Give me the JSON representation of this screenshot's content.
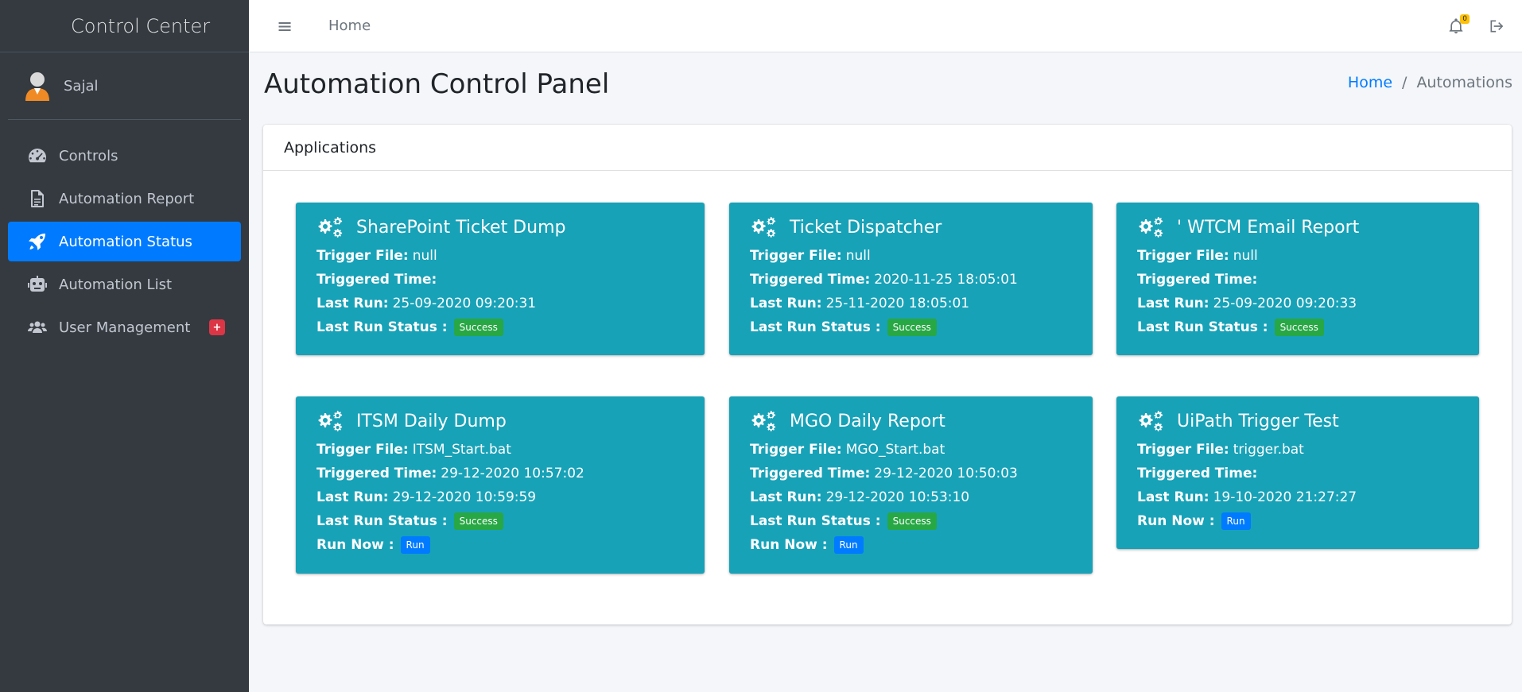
{
  "brand": {
    "title": "Control Center"
  },
  "user": {
    "name": "Sajal"
  },
  "sidebar": {
    "items": [
      {
        "label": "Controls",
        "icon": "tachometer-icon",
        "active": false
      },
      {
        "label": "Automation Report",
        "icon": "file-icon",
        "active": false
      },
      {
        "label": "Automation Status",
        "icon": "rocket-icon",
        "active": true
      },
      {
        "label": "Automation List",
        "icon": "robot-icon",
        "active": false
      },
      {
        "label": "User Management",
        "icon": "users-icon",
        "active": false,
        "badge": "+"
      }
    ]
  },
  "topbar": {
    "menu_icon": "≡",
    "home_label": "Home",
    "notification_count": "0"
  },
  "page": {
    "title": "Automation Control Panel",
    "breadcrumb": {
      "home": "Home",
      "separator": "/",
      "current": "Automations"
    }
  },
  "card": {
    "header": "Applications"
  },
  "labels": {
    "trigger_file": "Trigger File:",
    "triggered_time": "Triggered Time:",
    "last_run": "Last Run:",
    "last_run_status": "Last Run Status :",
    "run_now": "Run Now :",
    "run": "Run"
  },
  "apps": [
    {
      "title": "SharePoint Ticket Dump",
      "trigger_file": "null",
      "triggered_time": "",
      "last_run": "25-09-2020 09:20:31",
      "status": "Success"
    },
    {
      "title": "Ticket Dispatcher",
      "trigger_file": "null",
      "triggered_time": "2020-11-25 18:05:01",
      "last_run": "25-11-2020 18:05:01",
      "status": "Success"
    },
    {
      "title": "' WTCM Email Report",
      "trigger_file": "null",
      "triggered_time": "",
      "last_run": "25-09-2020 09:20:33",
      "status": "Success"
    },
    {
      "title": "ITSM Daily Dump",
      "trigger_file": "ITSM_Start.bat",
      "triggered_time": "29-12-2020 10:57:02",
      "last_run": "29-12-2020 10:59:59",
      "status": "Success"
    },
    {
      "title": "MGO Daily Report",
      "trigger_file": "MGO_Start.bat",
      "triggered_time": "29-12-2020 10:50:03",
      "last_run": "29-12-2020 10:53:10",
      "status": "Success"
    },
    {
      "title": "UiPath Trigger Test",
      "trigger_file": "trigger.bat",
      "triggered_time": "",
      "last_run": "19-10-2020 21:27:27"
    }
  ],
  "colors": {
    "sidebar_bg": "#343a40",
    "active": "#007bff",
    "app_box": "#17a2b8",
    "success": "#28a745",
    "badge_red": "#dc3545",
    "notif_badge": "#ffc107"
  }
}
